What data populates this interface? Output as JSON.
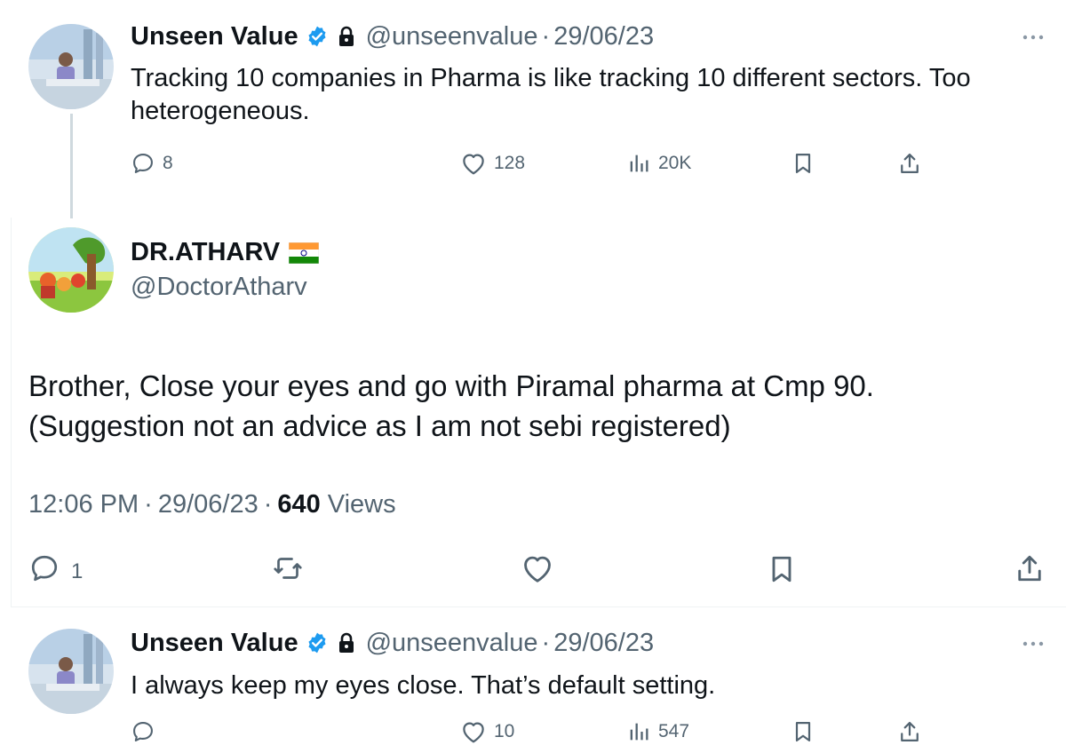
{
  "tweet1": {
    "name": "Unseen Value",
    "handle": "@unseenvalue",
    "separator": "·",
    "date": "29/06/23",
    "text": "Tracking 10 companies in Pharma is like tracking 10 different sectors. Too heterogeneous.",
    "replies": "8",
    "likes": "128",
    "views": "20K"
  },
  "main": {
    "name": "DR.ATHARV",
    "handle": "@DoctorAtharv",
    "text_line1": "Brother, Close your eyes and go with Piramal pharma at Cmp 90.",
    "text_line2": "(Suggestion not an advice as I am not sebi registered)",
    "time": "12:06 PM",
    "separator": "·",
    "date": "29/06/23",
    "views_count": "640",
    "views_label": "Views",
    "replies": "1"
  },
  "tweet3": {
    "name": "Unseen Value",
    "handle": "@unseenvalue",
    "separator": "·",
    "date": "29/06/23",
    "text": "I always keep my eyes close. That’s default setting.",
    "likes": "10",
    "views": "547"
  },
  "colors": {
    "text": "#0f1419",
    "muted": "#536471",
    "verified": "#1d9bf0",
    "thread_line": "#cfd9de"
  },
  "icons": [
    "reply-icon",
    "retweet-icon",
    "like-icon",
    "views-icon",
    "bookmark-icon",
    "share-icon",
    "verified-badge-icon",
    "lock-icon",
    "more-icon",
    "india-flag-icon"
  ]
}
